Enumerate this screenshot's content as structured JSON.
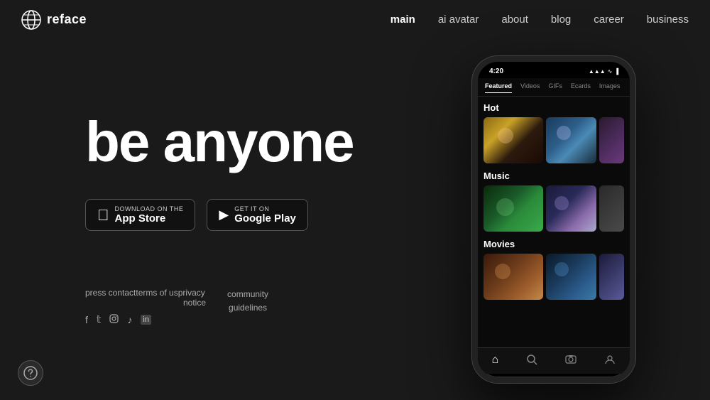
{
  "header": {
    "logo": {
      "text": "reface"
    },
    "nav": {
      "items": [
        {
          "label": "main",
          "active": true,
          "key": "main"
        },
        {
          "label": "ai avatar",
          "active": false,
          "key": "ai-avatar"
        },
        {
          "label": "about",
          "active": false,
          "key": "about"
        },
        {
          "label": "blog",
          "active": false,
          "key": "blog"
        },
        {
          "label": "career",
          "active": false,
          "key": "career"
        },
        {
          "label": "business",
          "active": false,
          "key": "business"
        }
      ]
    }
  },
  "hero": {
    "headline": "be anyone"
  },
  "store_buttons": {
    "app_store": {
      "small_text": "Download on the",
      "large_text": "App Store"
    },
    "google_play": {
      "small_text": "GET IT ON",
      "large_text": "Google Play"
    }
  },
  "footer": {
    "links": [
      {
        "label": "press contact",
        "key": "press-contact"
      },
      {
        "label": "terms of us",
        "key": "terms"
      },
      {
        "label": "privacy notice",
        "key": "privacy"
      }
    ],
    "community_guidelines": {
      "line1": "community",
      "line2": "guidelines"
    },
    "social": [
      {
        "icon": "f",
        "label": "facebook",
        "symbol": "𝕗"
      },
      {
        "icon": "t",
        "label": "twitter",
        "symbol": "𝕥"
      },
      {
        "icon": "ig",
        "label": "instagram",
        "symbol": "◻"
      },
      {
        "icon": "tt",
        "label": "tiktok",
        "symbol": "♪"
      },
      {
        "icon": "in",
        "label": "linkedin",
        "symbol": "in"
      }
    ]
  },
  "phone": {
    "status_bar": {
      "time": "4:20",
      "icons": "▲▲▐"
    },
    "tabs": [
      {
        "label": "Featured",
        "active": true
      },
      {
        "label": "Videos",
        "active": false
      },
      {
        "label": "GIFs",
        "active": false
      },
      {
        "label": "Ecards",
        "active": false
      },
      {
        "label": "Images",
        "active": false
      }
    ],
    "sections": [
      {
        "title": "Hot"
      },
      {
        "title": "Music"
      },
      {
        "title": "Movies"
      }
    ],
    "bottom_nav": [
      {
        "icon": "⌂",
        "active": true
      },
      {
        "icon": "⌕",
        "active": false
      },
      {
        "icon": "☁",
        "active": false
      },
      {
        "icon": "◉",
        "active": false
      }
    ]
  },
  "badge": {
    "icon": "⊕"
  }
}
